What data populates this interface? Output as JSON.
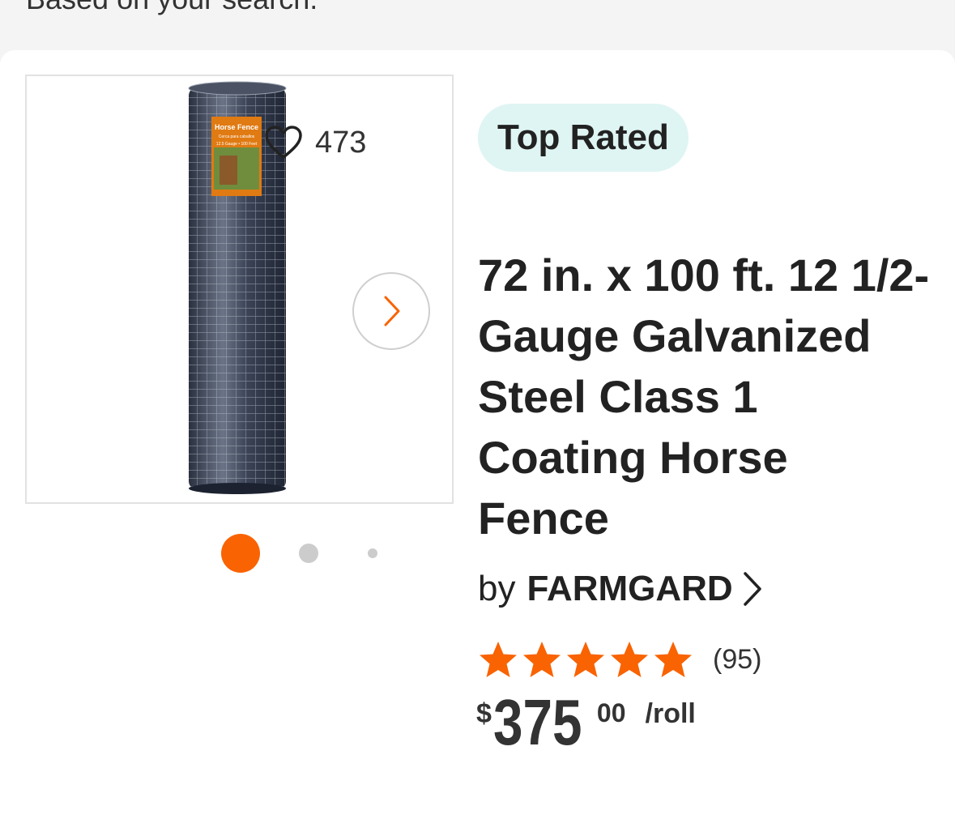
{
  "header": {
    "subtitle": "Based on your search."
  },
  "product": {
    "favorites_count": "473",
    "badge": "Top Rated",
    "title": "72 in. x 100 ft. 12 1/2-Gauge Galvanized Steel Class 1 Coating Horse Fence",
    "brand_prefix": "by",
    "brand": "FARMGARD",
    "rating": 5,
    "review_count": "(95)",
    "price": {
      "currency": "$",
      "dollars": "375",
      "cents": "00",
      "unit": "/roll"
    },
    "image_label": {
      "title": "Horse Fence",
      "subtitle": "Cerca para caballos",
      "spec": "12.5 Gauge • 100 Feet"
    },
    "carousel": {
      "total_dots": 3,
      "active_index": 0
    }
  },
  "colors": {
    "accent": "#f96302",
    "badge_bg": "#dff5f3",
    "dot_inactive": "#cccccc"
  },
  "icons": {
    "favorite": "heart-icon",
    "next": "chevron-right-icon",
    "brand_link": "chevron-right-icon",
    "rating": "star-icon"
  }
}
